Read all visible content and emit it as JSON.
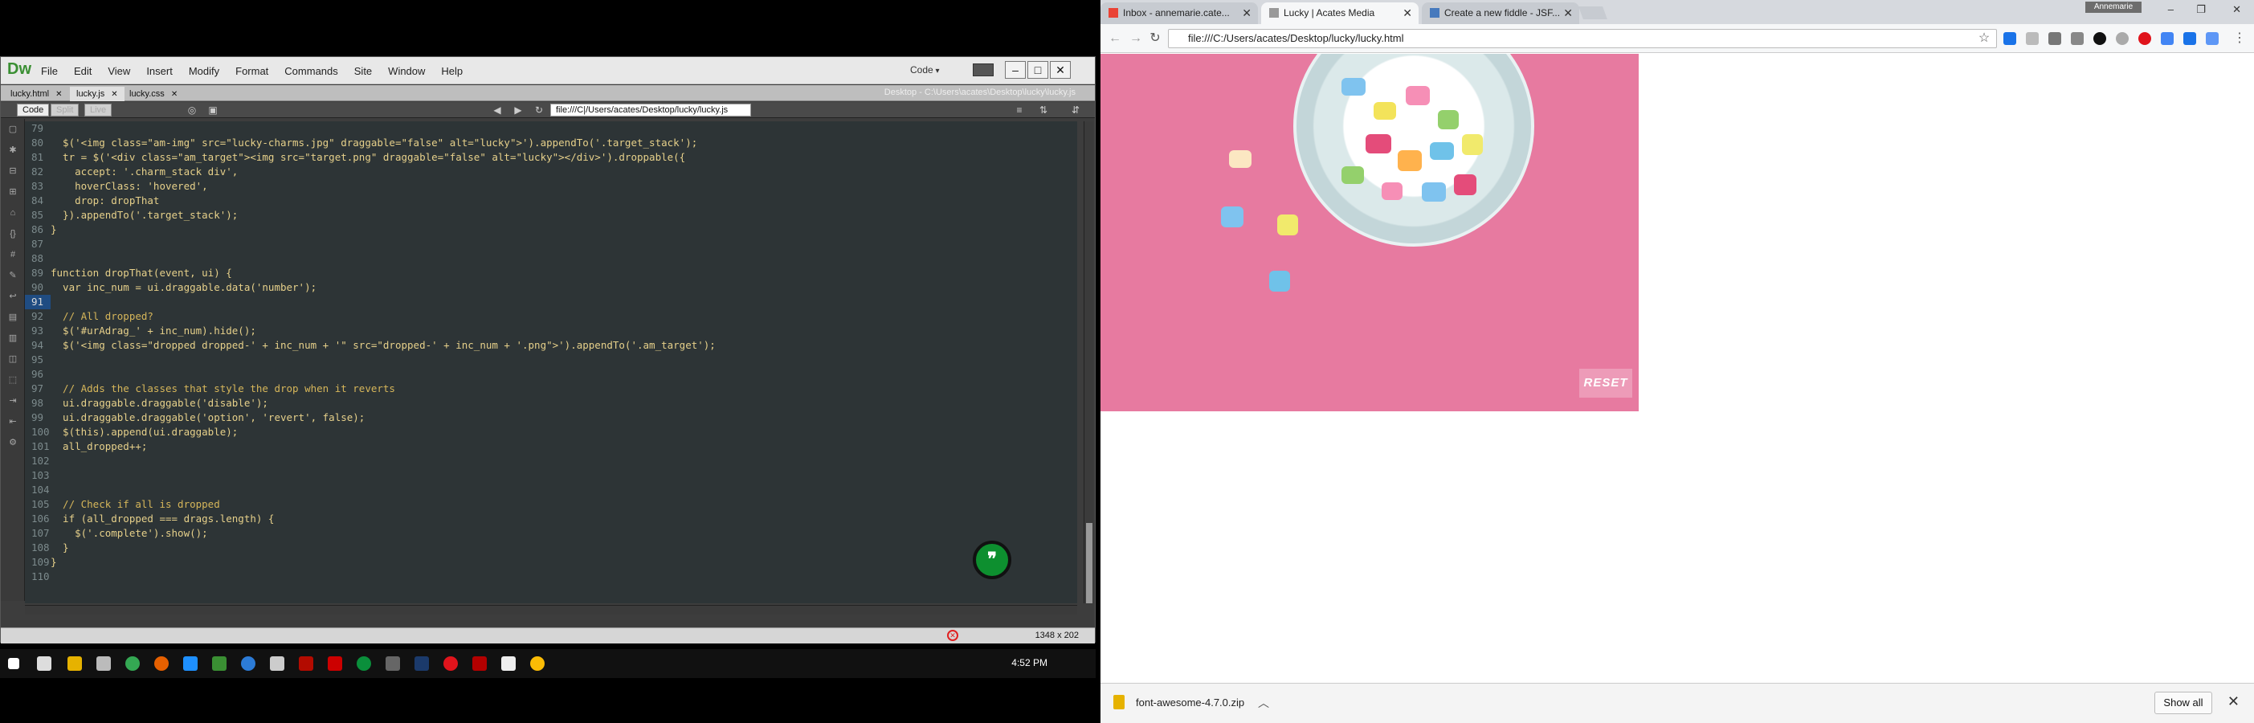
{
  "dreamweaver": {
    "logo": "Dw",
    "menu": [
      "File",
      "Edit",
      "View",
      "Insert",
      "Modify",
      "Format",
      "Commands",
      "Site",
      "Window",
      "Help"
    ],
    "view_select": "Code",
    "tabs": [
      {
        "label": "lucky.html"
      },
      {
        "label": "lucky.js",
        "active": true
      },
      {
        "label": "lucky.css"
      }
    ],
    "file_path": "Desktop - C:\\Users\\acates\\Desktop\\lucky\\lucky.js",
    "toolbar": {
      "code_button": "Code",
      "split_button": "Split",
      "live_button": "Live",
      "address": "file:///C|/Users/acates/Desktop/lucky/lucky.js"
    },
    "code_lines": [
      {
        "n": "79",
        "t": ""
      },
      {
        "n": "80",
        "t": "  $('<img class=\"am-img\" src=\"lucky-charms.jpg\" draggable=\"false\" alt=\"lucky\">').appendTo('.target_stack');"
      },
      {
        "n": "81",
        "t": "  tr = $('<div class=\"am_target\"><img src=\"target.png\" draggable=\"false\" alt=\"lucky\"></div>').droppable({"
      },
      {
        "n": "82",
        "t": "    accept: '.charm_stack div',"
      },
      {
        "n": "83",
        "t": "    hoverClass: 'hovered',"
      },
      {
        "n": "84",
        "t": "    drop: dropThat"
      },
      {
        "n": "85",
        "t": "  }).appendTo('.target_stack');"
      },
      {
        "n": "86",
        "t": "}"
      },
      {
        "n": "87",
        "t": ""
      },
      {
        "n": "88",
        "t": ""
      },
      {
        "n": "89",
        "t": "function dropThat(event, ui) {"
      },
      {
        "n": "90",
        "t": "  var inc_num = ui.draggable.data('number');"
      },
      {
        "n": "91",
        "t": "",
        "active": true
      },
      {
        "n": "92",
        "t": "  // All dropped?"
      },
      {
        "n": "93",
        "t": "  $('#urAdrag_' + inc_num).hide();"
      },
      {
        "n": "94",
        "t": "  $('<img class=\"dropped dropped-' + inc_num + '\" src=\"dropped-' + inc_num + '.png\">').appendTo('.am_target');"
      },
      {
        "n": "95",
        "t": ""
      },
      {
        "n": "96",
        "t": ""
      },
      {
        "n": "97",
        "t": "  // Adds the classes that style the drop when it reverts"
      },
      {
        "n": "98",
        "t": "  ui.draggable.draggable('disable');"
      },
      {
        "n": "99",
        "t": "  ui.draggable.draggable('option', 'revert', false);"
      },
      {
        "n": "100",
        "t": "  $(this).append(ui.draggable);"
      },
      {
        "n": "101",
        "t": "  all_dropped++;"
      },
      {
        "n": "102",
        "t": ""
      },
      {
        "n": "103",
        "t": ""
      },
      {
        "n": "104",
        "t": ""
      },
      {
        "n": "105",
        "t": "  // Check if all is dropped"
      },
      {
        "n": "106",
        "t": "  if (all_dropped === drags.length) {"
      },
      {
        "n": "107",
        "t": "    $('.complete').show();"
      },
      {
        "n": "108",
        "t": "  }"
      },
      {
        "n": "109",
        "t": "}"
      },
      {
        "n": "110",
        "t": ""
      }
    ],
    "status_size": "1348 x 202"
  },
  "taskbar": {
    "time": "4:52 PM"
  },
  "chrome": {
    "tabs": [
      {
        "label": "Inbox - annemarie.cate...",
        "icon": "gmail-icon"
      },
      {
        "label": "Lucky | Acates Media",
        "icon": "page-icon",
        "active": true
      },
      {
        "label": "Create a new fiddle - JSF...",
        "icon": "jsfiddle-icon"
      }
    ],
    "profile": "Annemarie",
    "url": "file:///C:/Users/acates/Desktop/lucky/lucky.html",
    "page": {
      "reset_label": "RESET"
    },
    "downloads": {
      "file": "font-awesome-4.7.0.zip",
      "show_all": "Show all"
    }
  },
  "colors": {
    "stage_pink": "#e77aa0",
    "dw_green": "#3a8f33",
    "code_bg": "#2d3436"
  }
}
